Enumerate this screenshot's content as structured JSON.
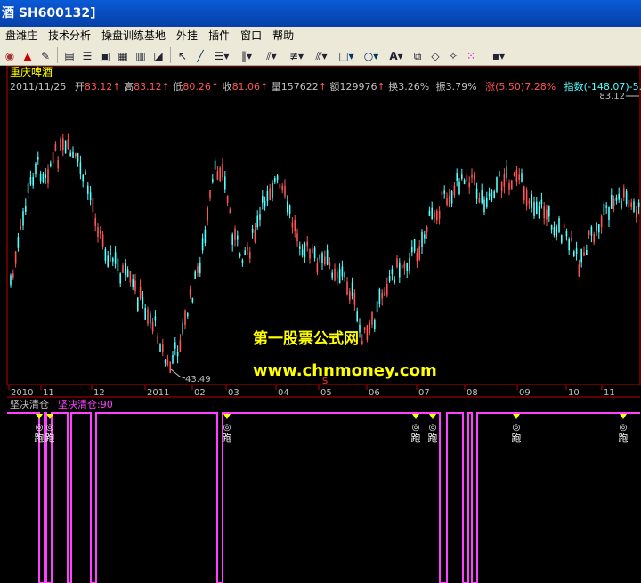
{
  "window": {
    "title": "酒  SH600132]"
  },
  "menu": [
    "盘潍庄",
    "技术分析",
    "操盘训练基地",
    "外挂",
    "插件",
    "窗口",
    "帮助"
  ],
  "toolbar": {
    "icons": [
      "chart-icon",
      "alert-bell-icon",
      "pen-icon",
      "layout-a-icon",
      "layout-b-icon",
      "layout-c-icon",
      "layout-d-icon",
      "layout-e-icon",
      "layout-f-icon",
      "cursor-arrow-icon",
      "line-tool-icon",
      "text-line-icon",
      "vertical-lines-icon",
      "fan-lines-icon",
      "channel-icon",
      "parallel-lines-icon",
      "rectangle-icon",
      "ellipse-icon",
      "text-icon",
      "copy-icon",
      "eraser-icon",
      "magic-icon",
      "color-palette-icon",
      "save-icon"
    ]
  },
  "quote": {
    "name": "重庆啤酒",
    "date": "2011/11/25",
    "open_label": "开",
    "open": "83.12",
    "high_label": "高",
    "high": "83.12",
    "low_label": "低",
    "low": "80.26",
    "close_label": "收",
    "close": "81.06",
    "volume_label": "量",
    "volume": "157622",
    "amount_label": "额",
    "amount": "129976",
    "turnover_label": "换",
    "turnover": "3.26%",
    "amplitude_label": "振",
    "amplitude": "3.79%",
    "change": "涨(5.50)7.28%",
    "index": "指数(-148.07)-5.86%",
    "right_price": "83.12",
    "low_marker": "43.49",
    "s_marker": "S"
  },
  "x_axis": [
    "2010",
    "11",
    "12",
    "2011",
    "02",
    "03",
    "04",
    "05",
    "06",
    "07",
    "08",
    "09",
    "10",
    "11"
  ],
  "watermark": {
    "line1": "第一股票公式网",
    "line2": "www.chnmoney.com"
  },
  "indicator": {
    "name": "坚决清仓",
    "param": "坚决清仓:90",
    "signal_text": "跑",
    "signal_symbol": "◎"
  },
  "colors": {
    "up": "#ff5555",
    "down": "#54ffff",
    "indicator": "#ff40ff",
    "signal": "#ffff00",
    "axis": "#c00000"
  }
}
